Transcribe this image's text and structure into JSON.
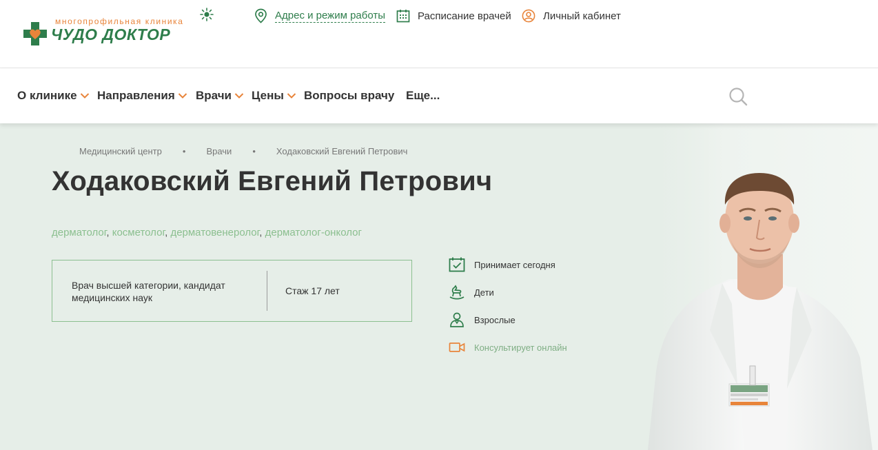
{
  "header": {
    "logo_tagline": "многопрофильная клиника",
    "logo_brand": "ЧУДО ДОКТОР",
    "links": [
      {
        "label": "Адрес и режим работы",
        "icon": "map-pin-icon"
      },
      {
        "label": "Расписание врачей",
        "icon": "calendar-icon"
      },
      {
        "label": "Личный кабинет",
        "icon": "user-circle-icon"
      }
    ]
  },
  "nav": {
    "items": [
      {
        "label": "О клинике",
        "has_dropdown": true
      },
      {
        "label": "Направления",
        "has_dropdown": true
      },
      {
        "label": "Врачи",
        "has_dropdown": true
      },
      {
        "label": "Цены",
        "has_dropdown": true
      },
      {
        "label": "Вопросы врачу",
        "has_dropdown": false
      },
      {
        "label": "Еще...",
        "has_dropdown": false
      }
    ],
    "search_icon": "search-icon"
  },
  "breadcrumbs": [
    "Медицинский центр",
    "Врачи",
    "Ходаковский Евгений Петрович"
  ],
  "doctor": {
    "name": "Ходаковский Евгений Петрович",
    "specialties": [
      "дерматолог",
      "косметолог",
      "дерматовенеролог",
      "дерматолог-онколог"
    ],
    "category": "Врач высшей категории, кандидат медицинских наук",
    "experience": "Стаж 17 лет",
    "features": [
      {
        "label": "Принимает сегодня",
        "icon": "calendar-check-icon"
      },
      {
        "label": "Дети",
        "icon": "rocking-horse-icon"
      },
      {
        "label": "Взрослые",
        "icon": "adult-person-icon"
      },
      {
        "label": "Консультирует онлайн",
        "icon": "video-camera-icon"
      }
    ]
  },
  "colors": {
    "brand_green": "#2e7d4b",
    "accent_orange": "#e8843a",
    "light_green": "#8bbf8f",
    "hero_bg": "#e6eee8"
  }
}
